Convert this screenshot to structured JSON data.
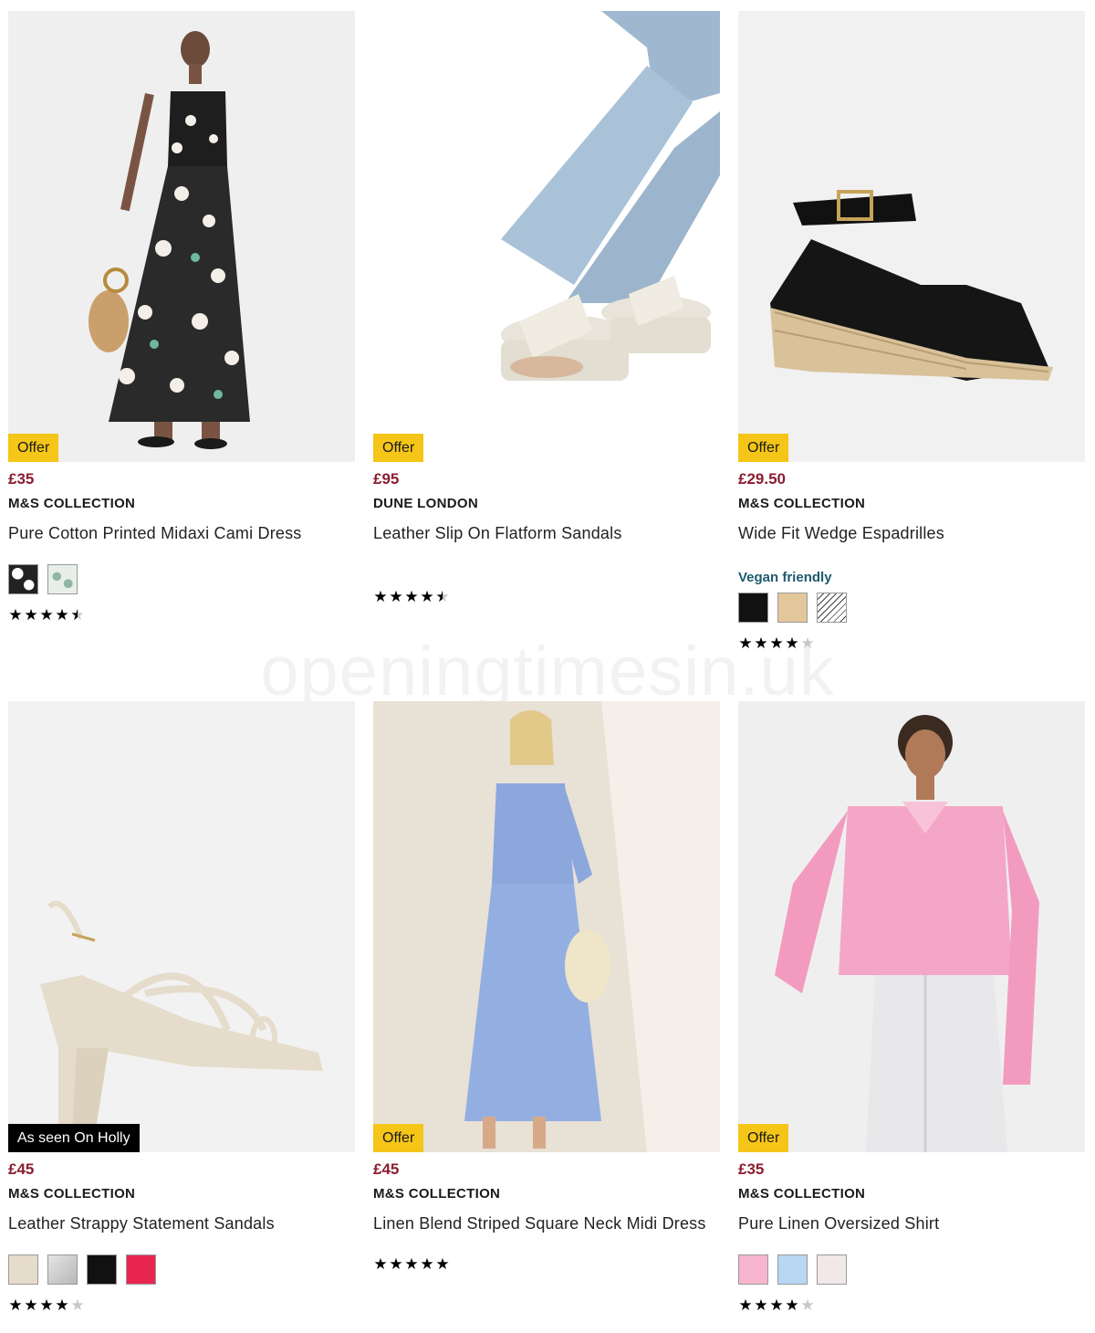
{
  "watermark": "openingtimesin.uk",
  "products": [
    {
      "badge": "Offer",
      "price": "£35",
      "brand": "M&S COLLECTION",
      "name": "Pure Cotton Printed Midaxi Cami Dress",
      "swatches": [
        "print-black",
        "print-green"
      ],
      "rating": 4.5,
      "vegan": ""
    },
    {
      "badge": "Offer",
      "price": "£95",
      "brand": "DUNE LONDON",
      "name": "Leather Slip On Flatform Sandals",
      "swatches": [],
      "rating": 4.5,
      "vegan": ""
    },
    {
      "badge": "Offer",
      "price": "£29.50",
      "brand": "M&S COLLECTION",
      "name": "Wide Fit Wedge Espadrilles",
      "swatches": [
        "#111111",
        "#e3c79a",
        "stripe"
      ],
      "rating": 4,
      "vegan": "Vegan friendly"
    },
    {
      "badge": "As seen On Holly",
      "price": "£45",
      "brand": "M&S COLLECTION",
      "name": "Leather Strappy Statement Sandals",
      "swatches": [
        "#e6dccb",
        "#c7c7c7",
        "#111111",
        "#e8264f"
      ],
      "rating": 4,
      "vegan": ""
    },
    {
      "badge": "Offer",
      "price": "£45",
      "brand": "M&S COLLECTION",
      "name": "Linen Blend Striped Square Neck Midi Dress",
      "swatches": [],
      "rating": 5,
      "vegan": ""
    },
    {
      "badge": "Offer",
      "price": "£35",
      "brand": "M&S COLLECTION",
      "name": "Pure Linen Oversized Shirt",
      "swatches": [
        "#f7b6cd",
        "#b9d6f2",
        "#f2e8ea"
      ],
      "rating": 4,
      "vegan": ""
    }
  ],
  "colors": {
    "price": "#8b1e2f",
    "offer_badge": "#f5c518",
    "vegan_text": "#1f5a6b"
  }
}
